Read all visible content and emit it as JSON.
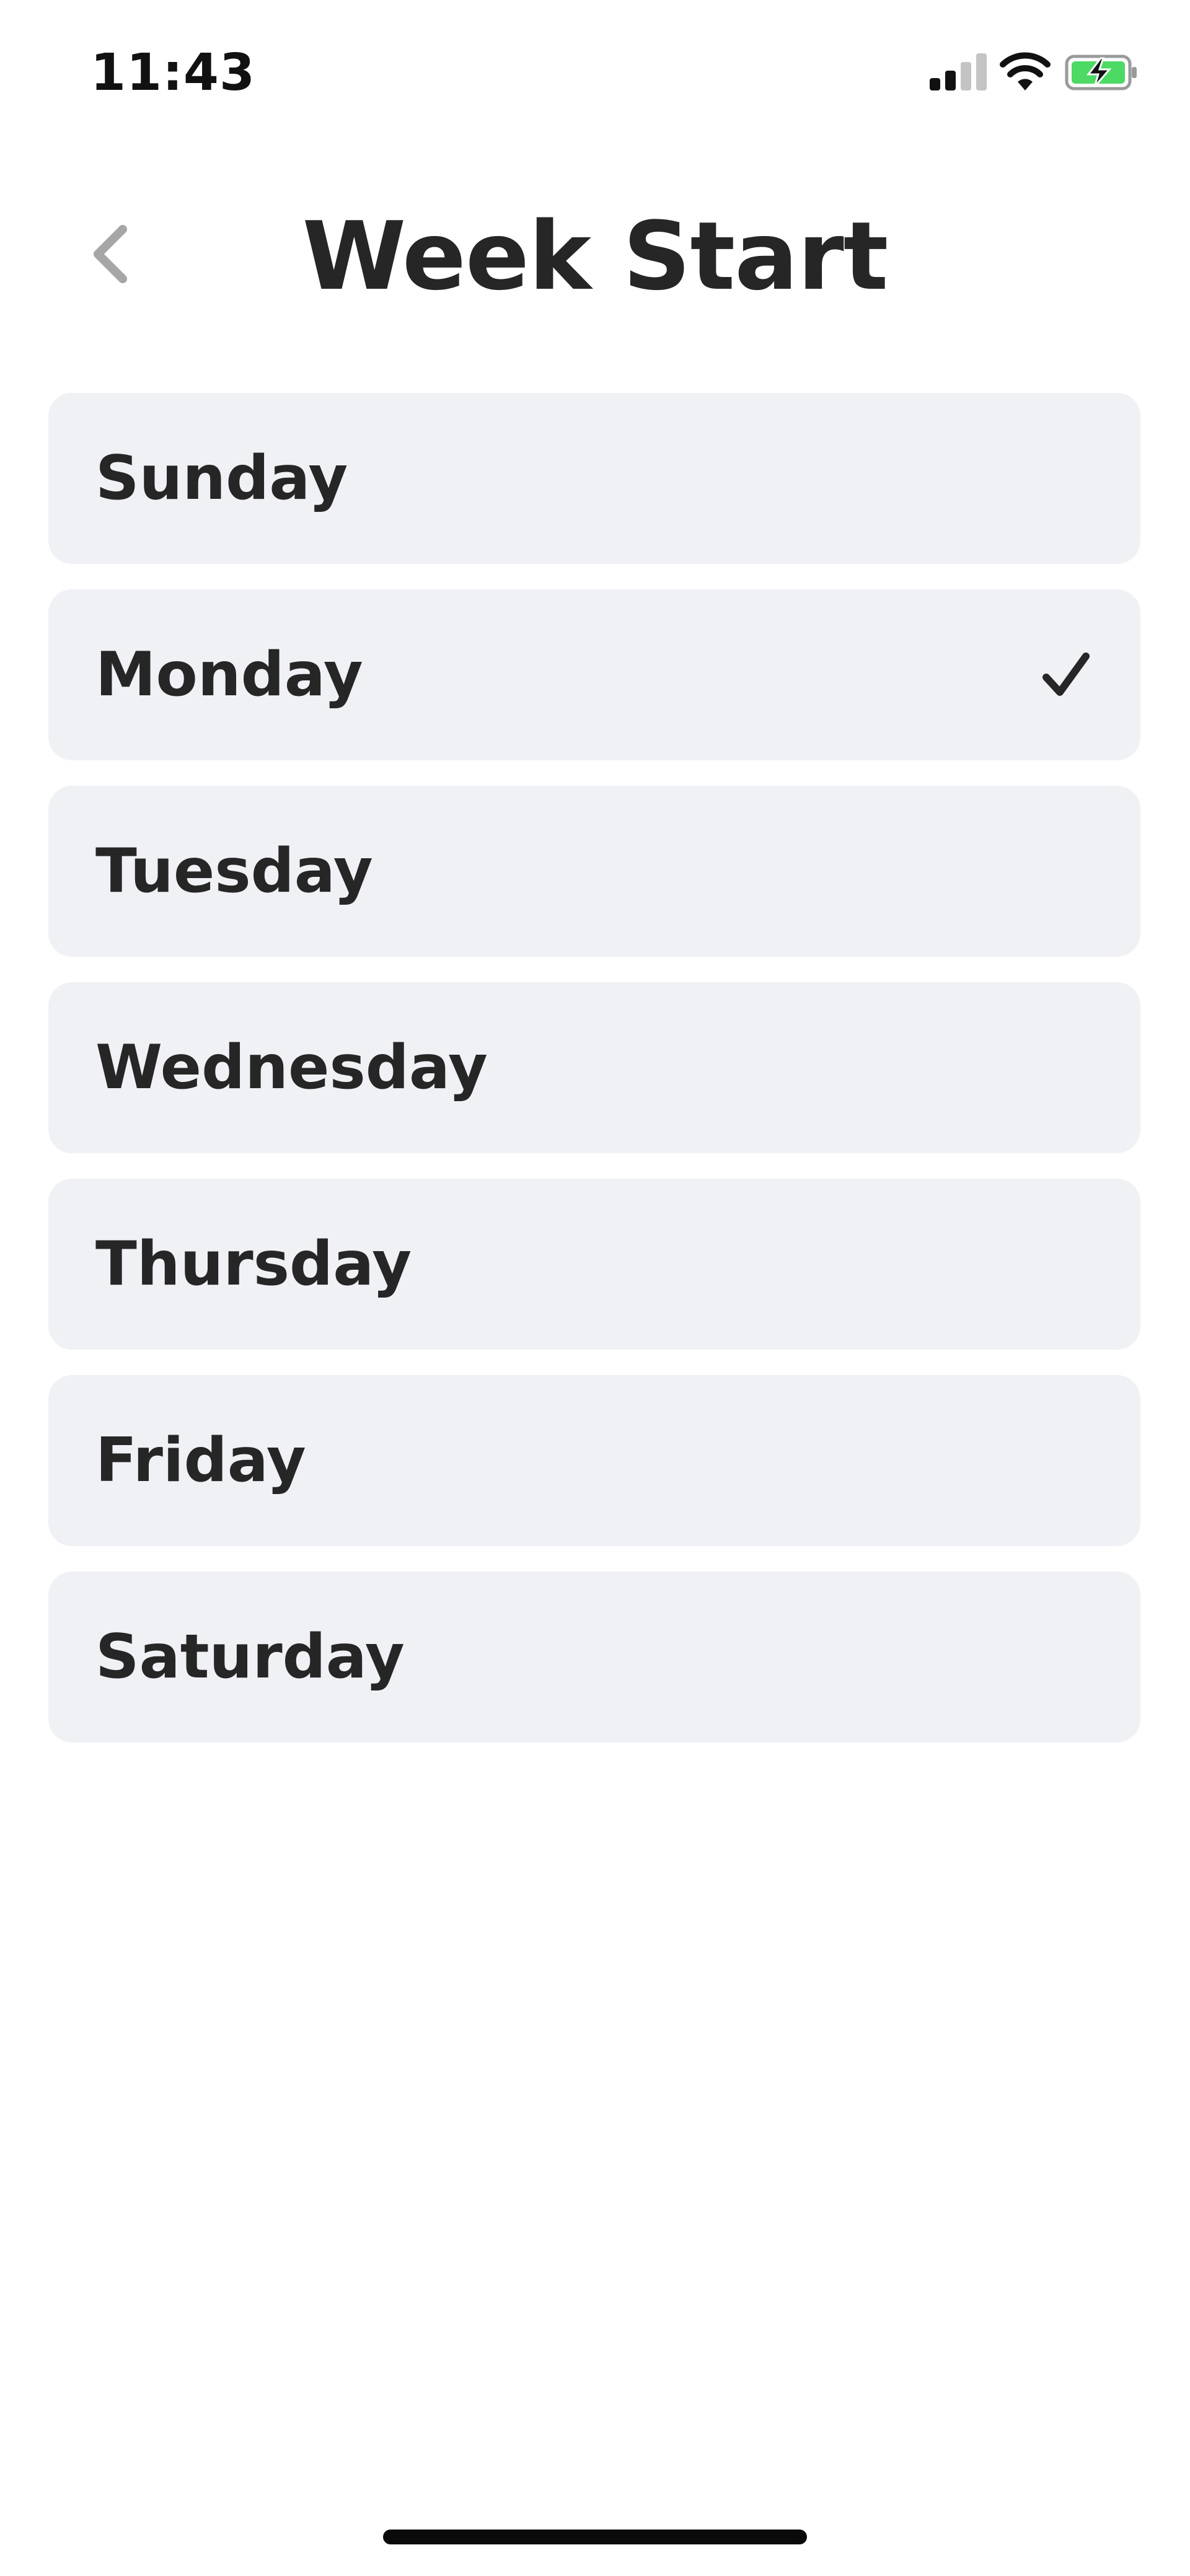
{
  "status_bar": {
    "time": "11:43"
  },
  "header": {
    "title": "Week Start",
    "back_icon": "chevron-left-icon"
  },
  "options": [
    {
      "label": "Sunday",
      "selected": false
    },
    {
      "label": "Monday",
      "selected": true
    },
    {
      "label": "Tuesday",
      "selected": false
    },
    {
      "label": "Wednesday",
      "selected": false
    },
    {
      "label": "Thursday",
      "selected": false
    },
    {
      "label": "Friday",
      "selected": false
    },
    {
      "label": "Saturday",
      "selected": false
    }
  ],
  "colors": {
    "row_background": "#f0f1f5",
    "text": "#262626",
    "back_chevron": "#a6a6a6",
    "battery_fill": "#4cd964"
  }
}
